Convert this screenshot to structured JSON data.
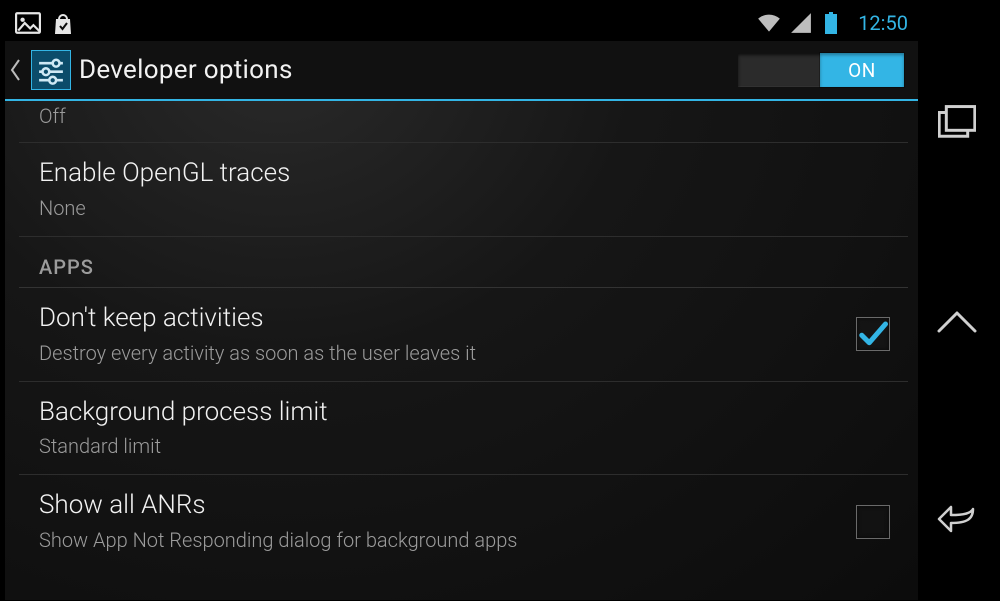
{
  "statusbar": {
    "clock": "12:50"
  },
  "actionbar": {
    "title": "Developer options",
    "switch_label": "ON"
  },
  "items": {
    "prev_summary": "Off",
    "opengl": {
      "title": "Enable OpenGL traces",
      "summary": "None"
    },
    "section_apps": "APPS",
    "dont_keep": {
      "title": "Don't keep activities",
      "summary": "Destroy every activity as soon as the user leaves it",
      "checked": true
    },
    "bg_limit": {
      "title": "Background process limit",
      "summary": "Standard limit"
    },
    "anr": {
      "title": "Show all ANRs",
      "summary": "Show App Not Responding dialog for background apps",
      "checked": false
    }
  }
}
